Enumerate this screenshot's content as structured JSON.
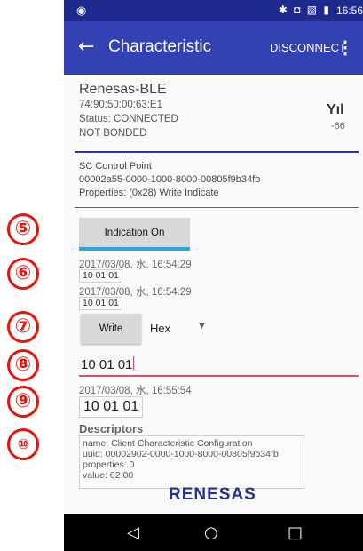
{
  "markers": [
    "⑤",
    "⑥",
    "⑦",
    "⑧",
    "⑨",
    "⑩"
  ],
  "status_bar": {
    "left_icon": "android-icon",
    "icons": "✱ ◘ ▧ ▮",
    "time": "16:56"
  },
  "app_bar": {
    "back_icon": "back-arrow-icon",
    "title": "Characteristic",
    "disconnect_label": "DISCONNECT",
    "menu_icon": "overflow-menu-icon"
  },
  "device": {
    "name": "Renesas-BLE",
    "address": "74:90:50:00:63:E1",
    "status": "Status: CONNECTED",
    "bond": "NOT BONDED",
    "signal_icon": "signal-strength-icon",
    "rssi": "-66"
  },
  "characteristic": {
    "name": "SC Control Point",
    "uuid": "00002a55-0000-1000-8000-00805f9b34fb",
    "properties": "Properties: (0x28) Write Indicate"
  },
  "indication": {
    "button_label": "Indication On",
    "events": [
      {
        "timestamp": "2017/03/08, 水, 16:54:29",
        "value": "10 01 01"
      },
      {
        "timestamp": "2017/03/08, 水, 16:54:29",
        "value": "10 01 01"
      }
    ]
  },
  "write": {
    "button_label": "Write",
    "format": "Hex",
    "input_value": "10 01 01",
    "result_timestamp": "2017/03/08, 水, 16:55:54",
    "result_value": "10 01 01"
  },
  "descriptors": {
    "heading": "Descriptors",
    "lines": [
      "name: Client Characteristic Configuration",
      "uuid: 00002902-0000-1000-8000-00805f9b34fb",
      "properties: 0",
      "value: 02 00"
    ]
  },
  "logo": "RENESAS",
  "nav": {
    "back": "◁",
    "home": "○",
    "recents": "□"
  },
  "colors": {
    "status_bar": "#1f2a8f",
    "app_bar": "#3441b5",
    "indicator": "#2aa7df",
    "input_underline": "#e54b6a",
    "marker": "#e8140a"
  }
}
